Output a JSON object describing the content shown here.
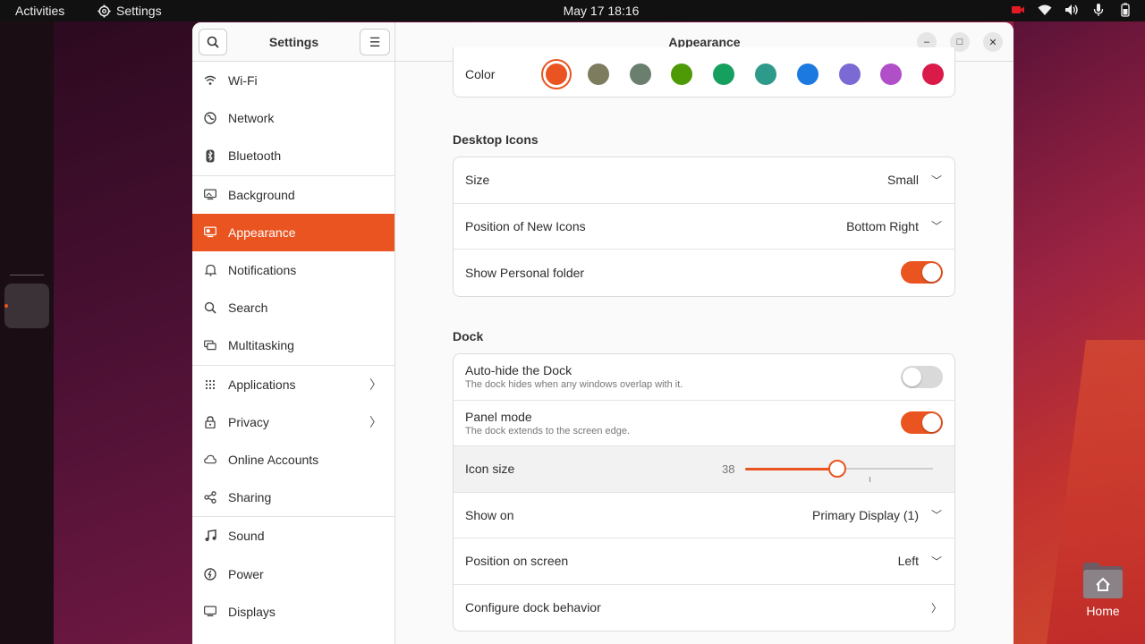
{
  "topbar": {
    "activities": "Activities",
    "app_name": "Settings",
    "clock": "May 17  18:16"
  },
  "desktop": {
    "home_label": "Home"
  },
  "window": {
    "sidebar_title": "Settings",
    "content_title": "Appearance"
  },
  "sidebar": {
    "items": [
      {
        "label": "Wi-Fi",
        "icon": "wifi-icon"
      },
      {
        "label": "Network",
        "icon": "network-icon"
      },
      {
        "label": "Bluetooth",
        "icon": "bluetooth-icon"
      },
      {
        "label": "Background",
        "icon": "background-icon"
      },
      {
        "label": "Appearance",
        "icon": "appearance-icon",
        "active": true
      },
      {
        "label": "Notifications",
        "icon": "bell-icon"
      },
      {
        "label": "Search",
        "icon": "search-icon"
      },
      {
        "label": "Multitasking",
        "icon": "multitasking-icon"
      },
      {
        "label": "Applications",
        "icon": "grid-icon"
      },
      {
        "label": "Privacy",
        "icon": "lock-icon"
      },
      {
        "label": "Online Accounts",
        "icon": "cloud-icon"
      },
      {
        "label": "Sharing",
        "icon": "share-icon"
      },
      {
        "label": "Sound",
        "icon": "music-note-icon"
      },
      {
        "label": "Power",
        "icon": "power-icon"
      },
      {
        "label": "Displays",
        "icon": "display-icon"
      }
    ]
  },
  "appearance": {
    "color_label": "Color",
    "colors": [
      "#e95420",
      "#7e7c5e",
      "#6b7f6e",
      "#4e9a06",
      "#15a05f",
      "#2e9a8a",
      "#1c79e0",
      "#7b6ad3",
      "#b04fc8",
      "#da1b4a"
    ],
    "selected_color": "#e95420",
    "desktop_icons_title": "Desktop Icons",
    "size_label": "Size",
    "size_value": "Small",
    "position_new_icons_label": "Position of New Icons",
    "position_new_icons_value": "Bottom Right",
    "show_personal_folder_label": "Show Personal folder",
    "show_personal_folder_on": true,
    "dock_title": "Dock",
    "auto_hide_label": "Auto-hide the Dock",
    "auto_hide_sub": "The dock hides when any windows overlap with it.",
    "auto_hide_on": false,
    "panel_mode_label": "Panel mode",
    "panel_mode_sub": "The dock extends to the screen edge.",
    "panel_mode_on": true,
    "icon_size_label": "Icon size",
    "icon_size_value": "38",
    "icon_size_fraction": 0.49,
    "show_on_label": "Show on",
    "show_on_value": "Primary Display (1)",
    "position_on_screen_label": "Position on screen",
    "position_on_screen_value": "Left",
    "configure_dock_label": "Configure dock behavior"
  }
}
